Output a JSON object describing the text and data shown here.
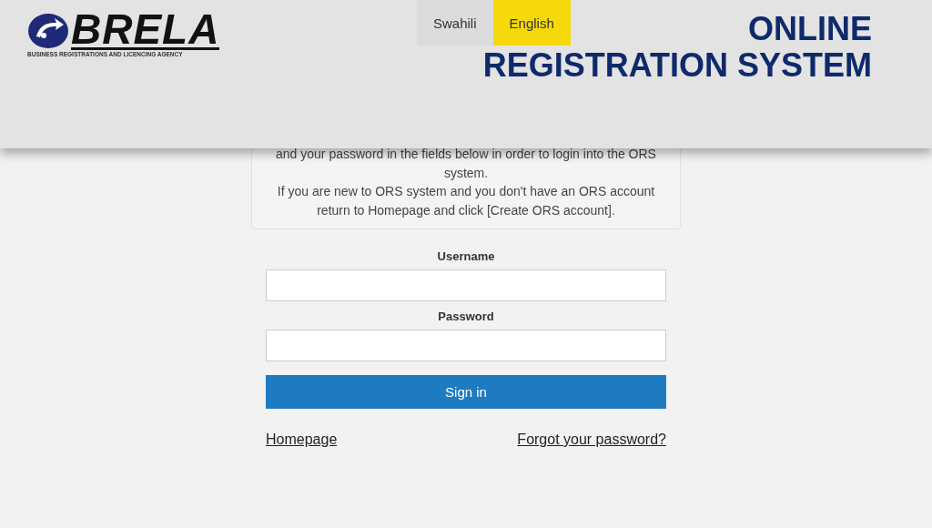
{
  "logo": {
    "name": "BRELA",
    "tagline": "BUSINESS REGISTRATIONS AND LICENCING AGENCY"
  },
  "languages": [
    {
      "label": "Swahili",
      "selected": false
    },
    {
      "label": "English",
      "selected": true
    }
  ],
  "title": [
    "ONLINE",
    "REGISTRATION SYSTEM"
  ],
  "info": [
    "and your password in the fields below in order to login into the ORS system.",
    "If you are new to ORS system and you don't have an ORS account return to Homepage and click [Create ORS account]."
  ],
  "form": {
    "username_label": "Username",
    "password_label": "Password",
    "submit": "Sign in"
  },
  "links": [
    "Homepage",
    "Forgot your password?"
  ]
}
